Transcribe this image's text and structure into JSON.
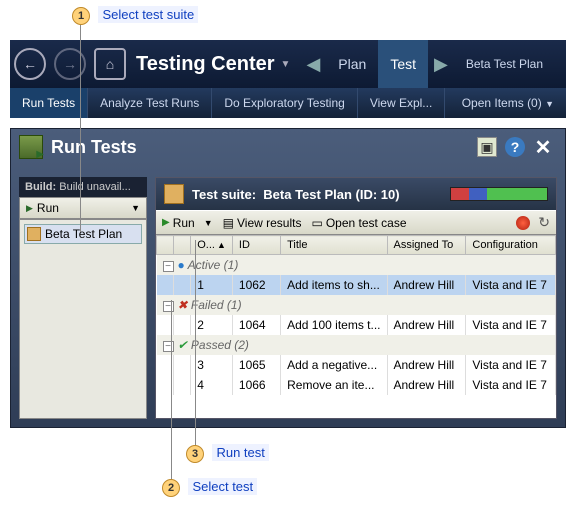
{
  "callouts": {
    "c1": {
      "num": "1",
      "label": "Select test suite"
    },
    "c2": {
      "num": "2",
      "label": "Select test"
    },
    "c3": {
      "num": "3",
      "label": "Run test"
    }
  },
  "window": {
    "min": "—",
    "max": "▢",
    "close": "✕"
  },
  "topnav": {
    "title": "Testing Center",
    "tabs": {
      "plan": "Plan",
      "test": "Test",
      "beta": "Beta Test Plan"
    }
  },
  "subnav": {
    "items": [
      "Run Tests",
      "Analyze Test Runs",
      "Do Exploratory Testing",
      "View Expl..."
    ],
    "open": "Open Items (0)"
  },
  "panel": {
    "title": "Run Tests",
    "help": "?",
    "close": "✕",
    "build_label": "Build:",
    "build_value": "Build unavail...",
    "run_btn": "Run",
    "tree_item": "Beta Test Plan"
  },
  "suite": {
    "label": "Test suite:",
    "name": "Beta Test Plan (ID: 10)"
  },
  "toolbar": {
    "run": "Run",
    "view": "View results",
    "open": "Open test case"
  },
  "columns": {
    "o": "O...",
    "id": "ID",
    "title": "Title",
    "assigned": "Assigned To",
    "config": "Configuration"
  },
  "groups": {
    "active": "Active (1)",
    "failed": "Failed (1)",
    "passed": "Passed (2)"
  },
  "rows": [
    {
      "n": "1",
      "id": "1062",
      "title": "Add items to sh...",
      "assigned": "Andrew Hill",
      "config": "Vista and IE 7"
    },
    {
      "n": "2",
      "id": "1064",
      "title": "Add 100 items t...",
      "assigned": "Andrew Hill",
      "config": "Vista and IE 7"
    },
    {
      "n": "3",
      "id": "1065",
      "title": "Add a negative...",
      "assigned": "Andrew Hill",
      "config": "Vista and IE 7"
    },
    {
      "n": "4",
      "id": "1066",
      "title": "Remove an ite...",
      "assigned": "Andrew Hill",
      "config": "Vista and IE 7"
    }
  ]
}
